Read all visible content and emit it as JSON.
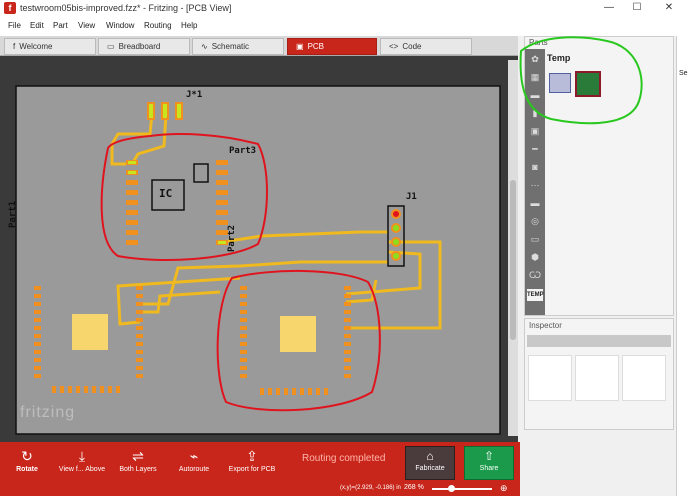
{
  "window": {
    "title": "testwroom05bis-improved.fzz* - Fritzing - [PCB View]",
    "app_icon": "f",
    "minimize": "—",
    "maximize": "☐",
    "close": "✕"
  },
  "menu": [
    "File",
    "Edit",
    "Part",
    "View",
    "Window",
    "Routing",
    "Help"
  ],
  "tabs": [
    {
      "label": "Welcome",
      "icon": "f"
    },
    {
      "label": "Breadboard",
      "icon": "▭"
    },
    {
      "label": "Schematic",
      "icon": "∿"
    },
    {
      "label": "PCB",
      "icon": "▣"
    },
    {
      "label": "Code",
      "icon": "<>"
    }
  ],
  "pcb": {
    "labels": {
      "j1": "J1",
      "jstar1": "J*1",
      "part1": "Part1",
      "part2": "Part2",
      "part3": "Part3",
      "ic": "IC"
    },
    "watermark": "fritzing"
  },
  "toolbar": {
    "rotate": "Rotate",
    "view_from_above": "View f... Above",
    "both_layers": "Both Layers",
    "autoroute": "Autoroute",
    "export": "Export for PCB",
    "status": "Routing completed",
    "fabricate": "Fabricate",
    "share": "Share"
  },
  "statusbar": {
    "coords": "(x,y)=(2.929, -0.186) in",
    "zoom": "268 %"
  },
  "parts_panel": {
    "title": "Parts",
    "bin_title": "Temp",
    "bin_tag": "TEMP",
    "search_hint": "Se"
  },
  "inspector": {
    "title": "Inspector"
  },
  "colors": {
    "accent": "#c8261b",
    "board": "#9a9a9a",
    "trace": "#f0b91e",
    "pad": "#f0901e",
    "annotation_red": "#e0141e",
    "annotation_green": "#28c81e",
    "share": "#1a9a4a"
  }
}
